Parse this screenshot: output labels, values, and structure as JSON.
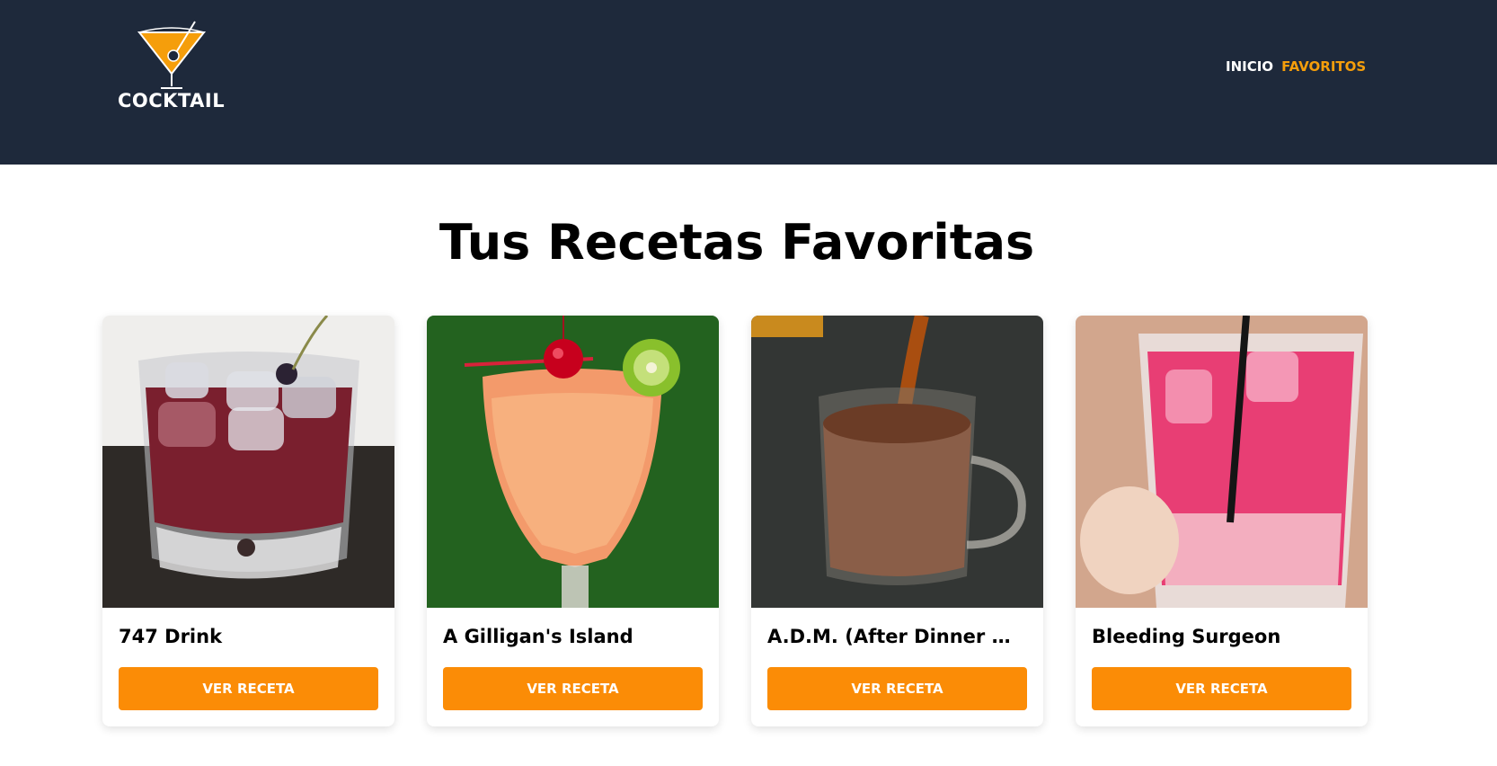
{
  "header": {
    "logo_text": "COCKTAIL",
    "nav": [
      {
        "label": "INICIO"
      },
      {
        "label": "FAVORITOS"
      }
    ]
  },
  "main": {
    "title": "Tus Recetas Favoritas",
    "cards": [
      {
        "name": "747 Drink",
        "button": "VER RECETA"
      },
      {
        "name": "A Gilligan's Island",
        "button": "VER RECETA"
      },
      {
        "name": "A.D.M. (After Dinner Mint)",
        "button": "VER RECETA"
      },
      {
        "name": "Bleeding Surgeon",
        "button": "VER RECETA"
      }
    ]
  },
  "colors": {
    "header_bg": "#1e293b",
    "accent": "#fb8c06"
  }
}
